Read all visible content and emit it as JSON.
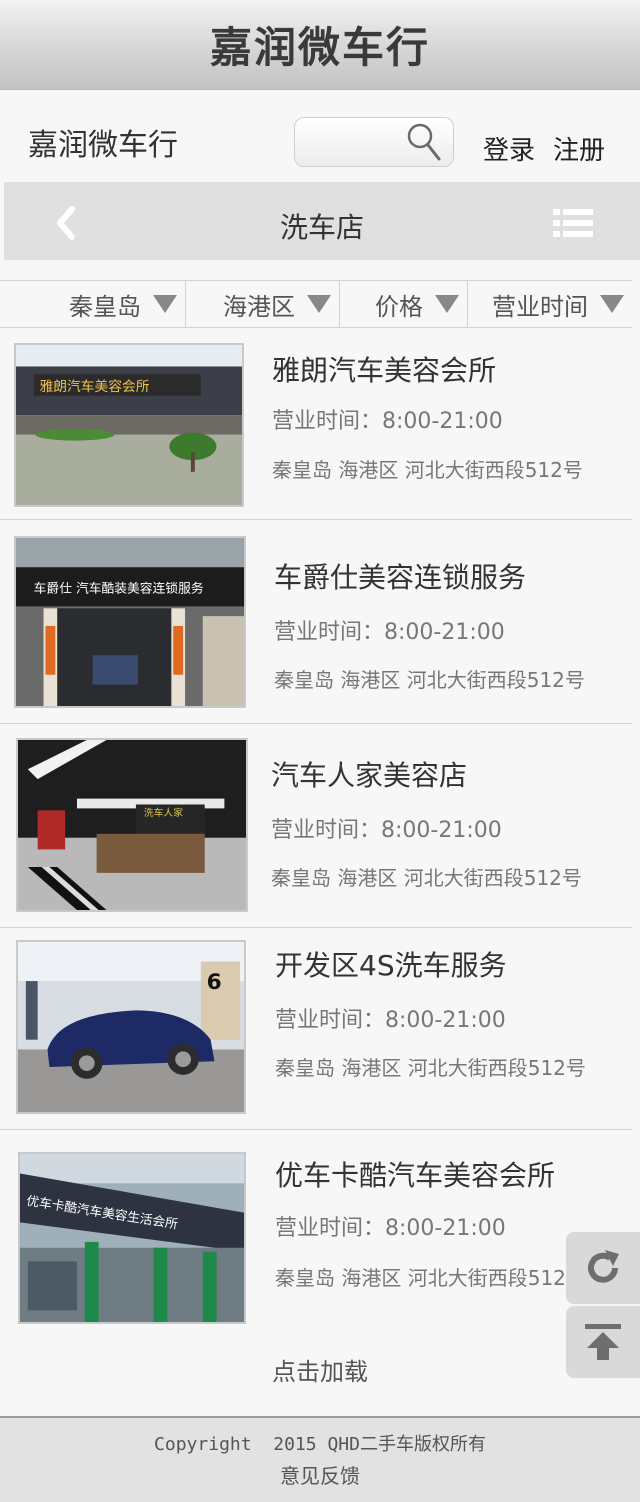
{
  "app_title": "嘉润微车行",
  "header": {
    "brand": "嘉润微车行",
    "search": {
      "placeholder": "",
      "value": ""
    },
    "login_label": "登录",
    "register_label": "注册"
  },
  "nav": {
    "title": "洗车店"
  },
  "filters": [
    {
      "label": "秦皇岛"
    },
    {
      "label": "海港区"
    },
    {
      "label": "价格"
    },
    {
      "label": "营业时间"
    }
  ],
  "shops": [
    {
      "name": "雅朗汽车美容会所",
      "hours": "营业时间：8:00-21:00",
      "address": "秦皇岛 海港区 河北大街西段512号",
      "sign_text": "雅朗汽车美容会所"
    },
    {
      "name": "车爵仕美容连锁服务",
      "hours": "营业时间：8:00-21:00",
      "address": "秦皇岛 海港区 河北大街西段512号",
      "sign_text": "车爵仕 汽车酷装美容连锁服务"
    },
    {
      "name": "汽车人家美容店",
      "hours": "营业时间：8:00-21:00",
      "address": "秦皇岛 海港区 河北大街西段512号",
      "sign_text": "洗车人家"
    },
    {
      "name": "开发区4S洗车服务",
      "hours": "营业时间：8:00-21:00",
      "address": "秦皇岛 海港区 河北大街西段512号",
      "sign_text": "6"
    },
    {
      "name": "优车卡酷汽车美容会所",
      "hours": "营业时间：8:00-21:00",
      "address": "秦皇岛 海港区 河北大街西段512号",
      "sign_text": "优车卡酷汽车美容生活会所"
    }
  ],
  "load_more_label": "点击加载",
  "footer": {
    "copyright": "Copyright  2015 QHD二手车版权所有",
    "feedback": "意见反馈"
  },
  "icons": {
    "search": "search-icon",
    "back": "chevron-left-icon",
    "menu": "list-menu-icon",
    "filter_arrow": "triangle-down-icon",
    "refresh": "refresh-icon",
    "top": "arrow-up-to-top-icon"
  },
  "colors": {
    "title_bar": "#d6d6d6",
    "nav_bar": "#e0e0e0",
    "background": "#f7f7f7",
    "text": "#333333",
    "muted_text": "#777777"
  }
}
